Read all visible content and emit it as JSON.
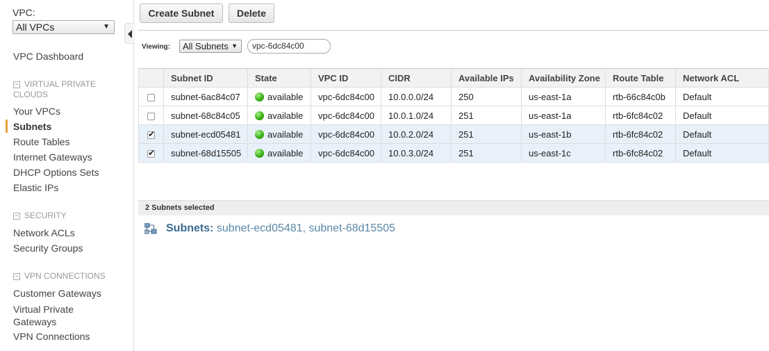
{
  "sidebar": {
    "vpc_label": "VPC:",
    "vpc_select": "All VPCs",
    "dashboard": "VPC Dashboard",
    "sections": [
      {
        "title": "VIRTUAL PRIVATE CLOUDS",
        "items": [
          "Your VPCs",
          "Subnets",
          "Route Tables",
          "Internet Gateways",
          "DHCP Options Sets",
          "Elastic IPs"
        ]
      },
      {
        "title": "SECURITY",
        "items": [
          "Network ACLs",
          "Security Groups"
        ]
      },
      {
        "title": "VPN CONNECTIONS",
        "items": [
          "Customer Gateways",
          "Virtual Private Gateways",
          "VPN Connections"
        ]
      }
    ],
    "active_item": "Subnets",
    "section_line1": "VIRTUAL PRIVATE",
    "section_line2": "CLOUDS",
    "vpg_line1": "Virtual Private",
    "vpg_line2": "Gateways"
  },
  "toolbar": {
    "create_label": "Create Subnet",
    "delete_label": "Delete"
  },
  "filter": {
    "viewing_label": "Viewing:",
    "viewing_value": "All Subnets",
    "search_value": "vpc-6dc84c00"
  },
  "table": {
    "columns": [
      "Subnet ID",
      "State",
      "VPC ID",
      "CIDR",
      "Available IPs",
      "Availability Zone",
      "Route Table",
      "Network ACL"
    ],
    "rows": [
      {
        "checked": false,
        "subnet_id": "subnet-6ac84c07",
        "state": "available",
        "vpc_id": "vpc-6dc84c00",
        "cidr": "10.0.0.0/24",
        "ips": "250",
        "az": "us-east-1a",
        "route_table": "rtb-66c84c0b",
        "acl": "Default"
      },
      {
        "checked": false,
        "subnet_id": "subnet-68c84c05",
        "state": "available",
        "vpc_id": "vpc-6dc84c00",
        "cidr": "10.0.1.0/24",
        "ips": "251",
        "az": "us-east-1a",
        "route_table": "rtb-6fc84c02",
        "acl": "Default"
      },
      {
        "checked": true,
        "subnet_id": "subnet-ecd05481",
        "state": "available",
        "vpc_id": "vpc-6dc84c00",
        "cidr": "10.0.2.0/24",
        "ips": "251",
        "az": "us-east-1b",
        "route_table": "rtb-6fc84c02",
        "acl": "Default"
      },
      {
        "checked": true,
        "subnet_id": "subnet-68d15505",
        "state": "available",
        "vpc_id": "vpc-6dc84c00",
        "cidr": "10.0.3.0/24",
        "ips": "251",
        "az": "us-east-1c",
        "route_table": "rtb-6fc84c02",
        "acl": "Default"
      }
    ]
  },
  "details": {
    "selected_count_text": "2 Subnets selected",
    "subnets_label": "Subnets:",
    "subnets_value": "subnet-ecd05481, subnet-68d15505"
  },
  "colors": {
    "accent_orange": "#e8a13a",
    "link_blue": "#3a6b91",
    "status_green": "#3cb016",
    "selected_row": "#e8f0fa"
  }
}
